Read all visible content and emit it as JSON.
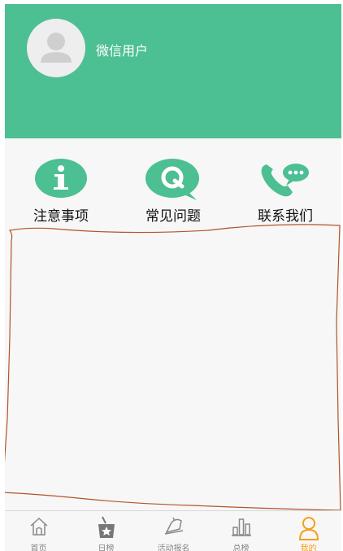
{
  "profile": {
    "username": "微信用户",
    "avatar_icon": "default-user-icon"
  },
  "shortcuts": [
    {
      "label": "注意事项",
      "icon": "info-icon"
    },
    {
      "label": "常见问题",
      "icon": "faq-q-icon"
    },
    {
      "label": "联系我们",
      "icon": "phone-chat-icon"
    }
  ],
  "tabbar": {
    "items": [
      {
        "label": "首页",
        "icon": "home-icon",
        "active": false
      },
      {
        "label": "日榜",
        "icon": "daily-rank-icon",
        "active": false
      },
      {
        "label": "活动报名",
        "icon": "activity-signup-icon",
        "active": false
      },
      {
        "label": "总榜",
        "icon": "total-rank-icon",
        "active": false
      },
      {
        "label": "我的",
        "icon": "profile-icon",
        "active": true
      }
    ]
  },
  "colors": {
    "header_green": "#4cbf93",
    "icon_green": "#4cbf93",
    "tab_active": "#f5a01a",
    "tab_inactive": "#888888",
    "sketch_line": "#b0552a"
  }
}
